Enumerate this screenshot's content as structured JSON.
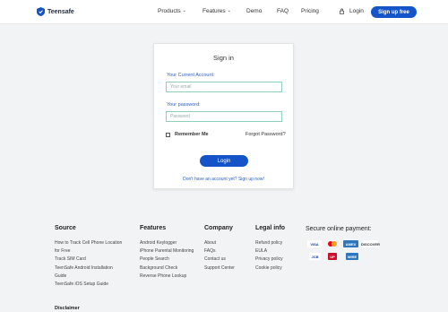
{
  "header": {
    "logo_text": "Teensafe",
    "nav": {
      "products": "Products",
      "features": "Features",
      "demo": "Demo",
      "faq": "FAQ",
      "pricing": "Pricing",
      "login": "Login",
      "signup": "Sign up free"
    },
    "colors": {
      "accent": "#1554c8"
    }
  },
  "signin": {
    "title": "Sign in",
    "account_label": "Your Current Account:",
    "account_placeholder": "Your email",
    "password_label": "Your password:",
    "password_placeholder": "Password",
    "remember_label": "Remember Me",
    "forgot_label": "Forgot Password?",
    "login_button": "Login",
    "signup_prompt": "Don't have an account yet? Sign up now!"
  },
  "footer": {
    "columns": [
      {
        "title": "Source",
        "items": [
          "How to Track Cell Phone Location for Free",
          "Track SIM Card",
          "TeenSafe Android Installation Guide",
          "TeenSafe iOS Setup Guide"
        ]
      },
      {
        "title": "Features",
        "items": [
          "Android Keylogger",
          "iPhone Parental Monitoring",
          "People Search",
          "Background Check",
          "Reverse Phone Lookup"
        ]
      },
      {
        "title": "Company",
        "items": [
          "About",
          "FAQs",
          "Contact us",
          "Support Center"
        ]
      },
      {
        "title": "Legal info",
        "items": [
          "Refund policy",
          "EULA",
          "Privacy policy",
          "Cookie policy"
        ]
      }
    ],
    "secure_title": "Secure online payment:",
    "payments": {
      "visa": "VISA",
      "amex": "AMEX",
      "discover": "DISCOVER",
      "jcb": "JCB",
      "union": "UP",
      "wire": "WIRE"
    },
    "disclaimer": "Disclaimer"
  }
}
